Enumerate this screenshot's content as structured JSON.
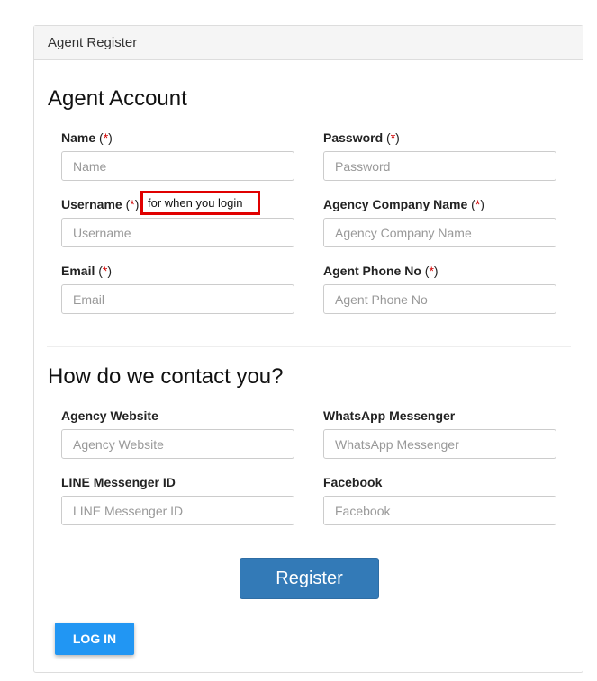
{
  "panel": {
    "title": "Agent Register"
  },
  "account_section": {
    "heading": "Agent Account",
    "required_marker": "*",
    "fields": {
      "name": {
        "label": "Name",
        "placeholder": "Name"
      },
      "password": {
        "label": "Password",
        "placeholder": "Password"
      },
      "username": {
        "label": "Username",
        "placeholder": "Username",
        "note": "for when you login"
      },
      "agency_company": {
        "label": "Agency Company Name",
        "placeholder": "Agency Company Name"
      },
      "email": {
        "label": "Email",
        "placeholder": "Email"
      },
      "phone": {
        "label": "Agent Phone No",
        "placeholder": "Agent Phone No"
      }
    }
  },
  "contact_section": {
    "heading": "How do we contact you?",
    "fields": {
      "website": {
        "label": "Agency Website",
        "placeholder": "Agency Website"
      },
      "whatsapp": {
        "label": "WhatsApp Messenger",
        "placeholder": "WhatsApp Messenger"
      },
      "line": {
        "label": "LINE Messenger ID",
        "placeholder": "LINE Messenger ID"
      },
      "facebook": {
        "label": "Facebook",
        "placeholder": "Facebook"
      }
    }
  },
  "actions": {
    "register_label": "Register",
    "login_label": "LOG IN"
  },
  "colors": {
    "required": "#d00000",
    "register_button": "#337ab7",
    "login_button": "#2196f3",
    "note_border": "#e00000"
  }
}
